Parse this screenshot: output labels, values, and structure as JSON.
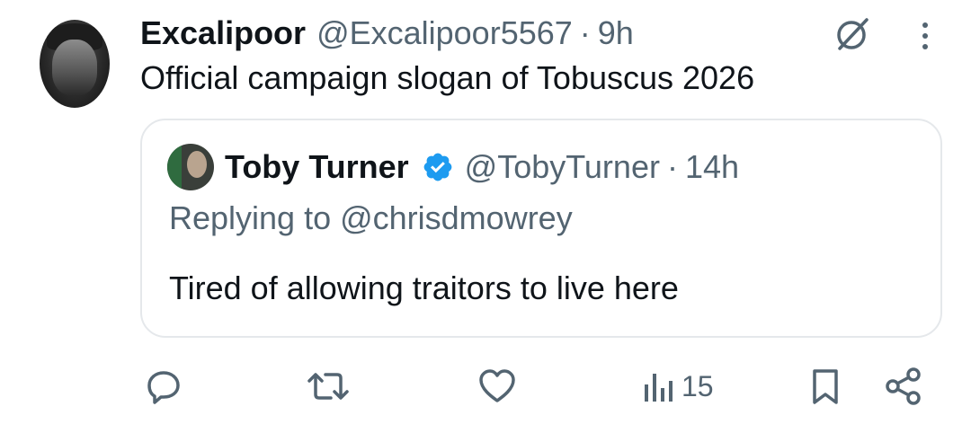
{
  "tweet": {
    "author_name": "Excalipoor",
    "author_handle": "@Excalipoor5567",
    "separator": "·",
    "time": "9h",
    "text": "Official campaign slogan of Tobuscus 2026"
  },
  "quoted_tweet": {
    "author_name": "Toby Turner",
    "author_handle": "@TobyTurner",
    "separator": "·",
    "time": "14h",
    "replying_to": "Replying to @chrisdmowrey",
    "text": "Tired of allowing traitors to live here",
    "verified": true
  },
  "actions": {
    "views": "15"
  },
  "colors": {
    "text_primary": "#0f1419",
    "text_secondary": "#536471",
    "verified_blue": "#1d9bf0",
    "border": "#e5e8eb"
  },
  "icons": {
    "grok": "grok-icon",
    "more": "more-icon",
    "reply": "reply-icon",
    "repost": "repost-icon",
    "like": "like-icon",
    "views": "views-icon",
    "bookmark": "bookmark-icon",
    "share": "share-icon",
    "verified": "verified-badge-icon"
  }
}
